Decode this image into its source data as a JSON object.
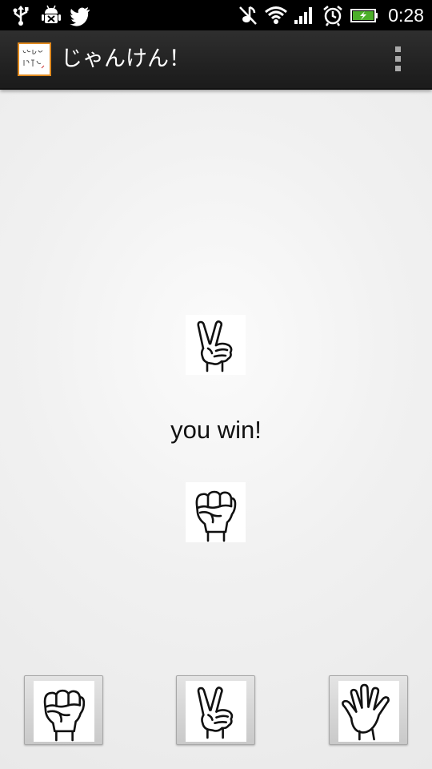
{
  "status_bar": {
    "icons": [
      "usb-icon",
      "android-debug-icon",
      "twitter-icon",
      "mute-icon",
      "wifi-icon",
      "signal-icon",
      "alarm-icon",
      "battery-charging-icon"
    ],
    "time": "0:28",
    "battery_color": "#4caf2a"
  },
  "action_bar": {
    "title": "じゃんけん！",
    "app_icon": "janken-app-icon",
    "overflow_icon": "overflow-menu-icon"
  },
  "game": {
    "cpu_hand": "scissors",
    "player_hand": "rock",
    "result": "you win!"
  },
  "choices": [
    {
      "hand": "rock",
      "icon": "rock-hand-icon"
    },
    {
      "hand": "scissors",
      "icon": "scissors-hand-icon"
    },
    {
      "hand": "paper",
      "icon": "paper-hand-icon"
    }
  ]
}
